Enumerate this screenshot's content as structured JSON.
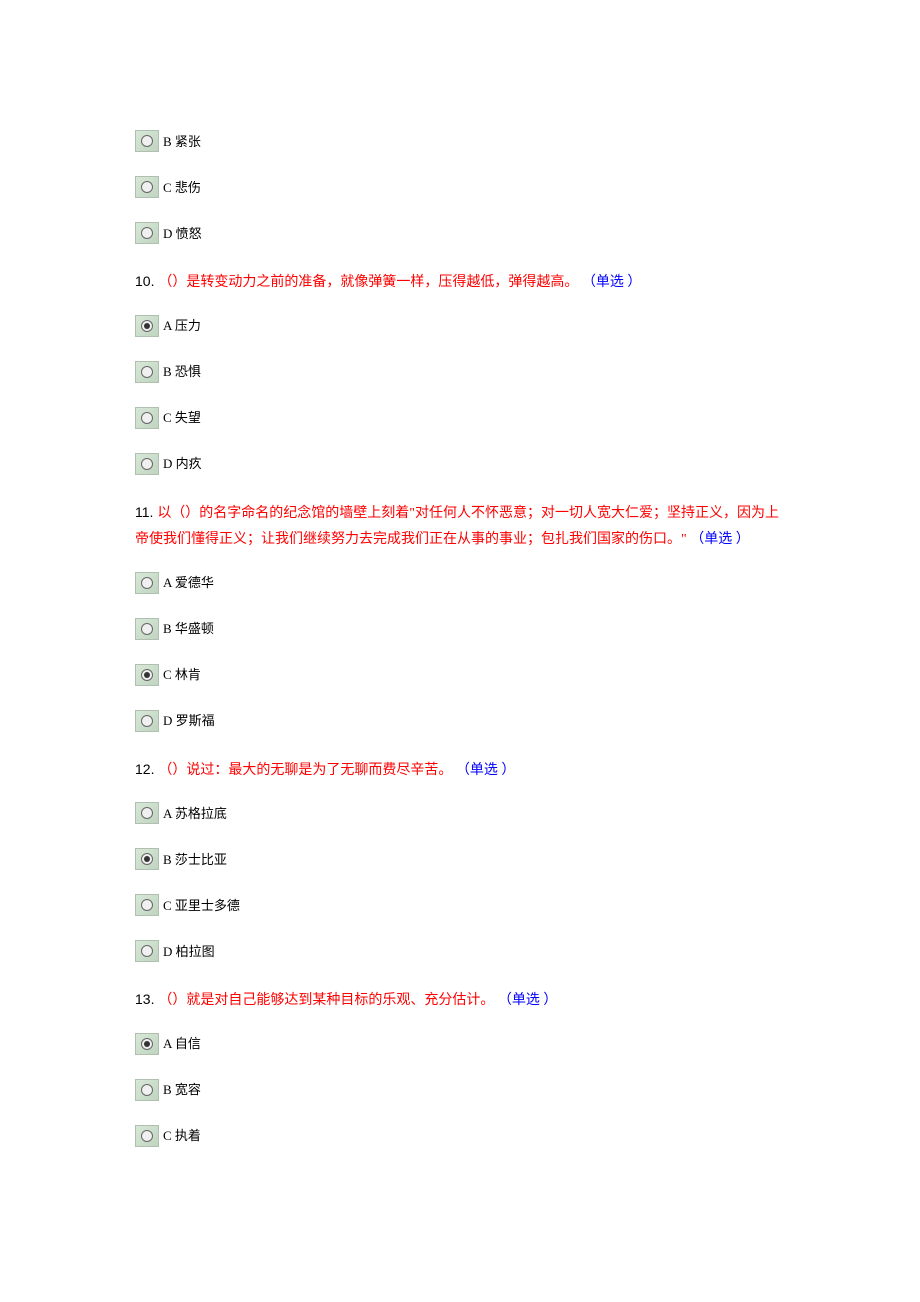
{
  "partial_options_top": [
    {
      "letter": "B",
      "text": "紧张",
      "selected": false
    },
    {
      "letter": "C",
      "text": "悲伤",
      "selected": false
    },
    {
      "letter": "D",
      "text": "愤怒",
      "selected": false
    }
  ],
  "questions": [
    {
      "num": "10.",
      "text": "（）是转变动力之前的准备，就像弹簧一样，压得越低，弹得越高。",
      "type": "（单选 ）",
      "options": [
        {
          "letter": "A",
          "text": "压力",
          "selected": true
        },
        {
          "letter": "B",
          "text": "恐惧",
          "selected": false
        },
        {
          "letter": "C",
          "text": "失望",
          "selected": false
        },
        {
          "letter": "D",
          "text": "内疚",
          "selected": false
        }
      ]
    },
    {
      "num": "11.",
      "text": "以（）的名字命名的纪念馆的墙壁上刻着\"对任何人不怀恶意；对一切人宽大仁爱；坚持正义，因为上帝使我们懂得正义；让我们继续努力去完成我们正在从事的事业；包扎我们国家的伤口。\"",
      "type": "（单选 ）",
      "options": [
        {
          "letter": "A",
          "text": "爱德华",
          "selected": false
        },
        {
          "letter": "B",
          "text": "华盛顿",
          "selected": false
        },
        {
          "letter": "C",
          "text": "林肯",
          "selected": true
        },
        {
          "letter": "D",
          "text": "罗斯福",
          "selected": false
        }
      ]
    },
    {
      "num": "12.",
      "text": "（）说过：最大的无聊是为了无聊而费尽辛苦。",
      "type": "（单选 ）",
      "options": [
        {
          "letter": "A",
          "text": "苏格拉底",
          "selected": false
        },
        {
          "letter": "B",
          "text": "莎士比亚",
          "selected": true
        },
        {
          "letter": "C",
          "text": "亚里士多德",
          "selected": false
        },
        {
          "letter": "D",
          "text": "柏拉图",
          "selected": false
        }
      ]
    },
    {
      "num": "13.",
      "text": "（）就是对自己能够达到某种目标的乐观、充分估计。",
      "type": "（单选 ）",
      "options": [
        {
          "letter": "A",
          "text": "自信",
          "selected": true
        },
        {
          "letter": "B",
          "text": "宽容",
          "selected": false
        },
        {
          "letter": "C",
          "text": "执着",
          "selected": false
        }
      ]
    }
  ]
}
